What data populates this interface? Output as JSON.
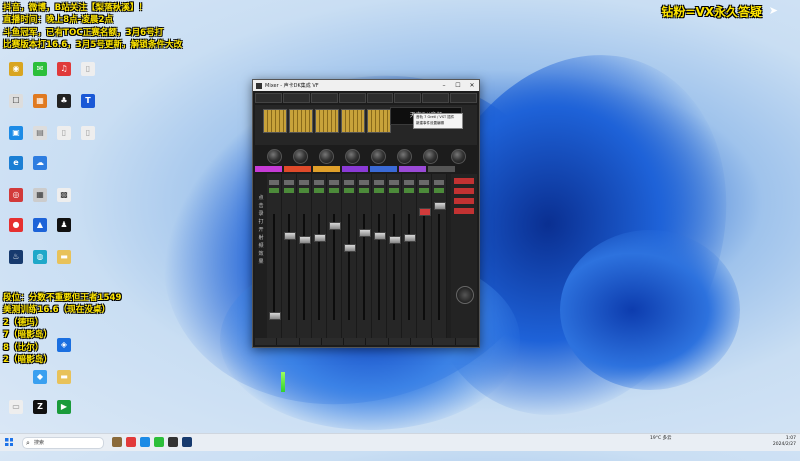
{
  "overlay": {
    "top_lines": [
      "抖音，微博，B站关注【梨落秋溪】！",
      "直播时间：晚上8点-凌晨2点",
      "斗鱼冠军，已有TOC正赛名额，3月6号打",
      "比赛版本打16.6，3月5号更新，解锁条件大改"
    ],
    "bottom_lines": [
      "段位：分数不重要但王者1549",
      "美测训练16.6（现在没桌）",
      "2（德玛）",
      "7（暗影岛）",
      "8（比尔）",
      "2（暗影岛）"
    ],
    "right_text": "钻粉=VX永久答疑"
  },
  "mixer": {
    "title": "Mixer - 声卡DK集成 VF",
    "header_box": "天空DK音频",
    "popup_line1": "音轨 7 Gretl / VST 插件",
    "popup_line2": "新建事件设置编辑",
    "side_labels": [
      "点",
      "击",
      "录",
      "打",
      "开",
      "射",
      "频",
      "效",
      "果"
    ]
  },
  "taskbar": {
    "search_placeholder": "搜索",
    "weather": "19°C\n多云",
    "time": "1:07",
    "date": "2024/2/27"
  },
  "colors": {
    "overlay_text": "#ffe600",
    "accent": "#1e73e8",
    "mixer_bg": "#1c1c1c",
    "preset_gold": "#c8a23a"
  }
}
